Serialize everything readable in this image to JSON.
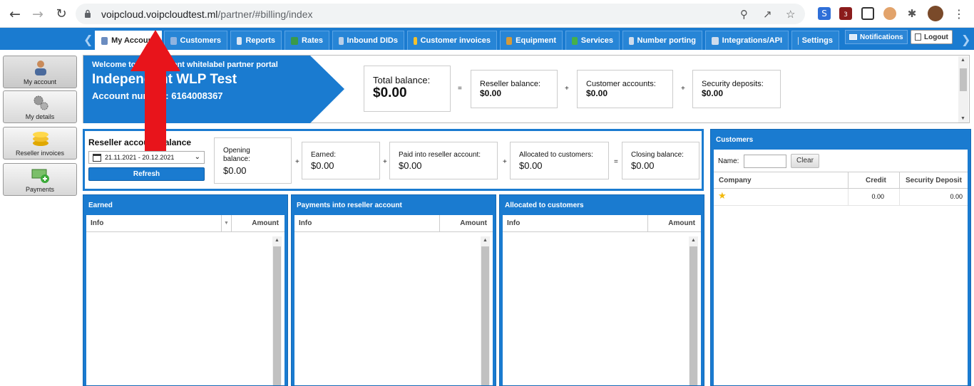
{
  "browser": {
    "url_host": "voipcloud.voipcloudtest.ml",
    "url_path": "/partner/#billing/index",
    "ext_badge": "3"
  },
  "nav": {
    "tabs": [
      {
        "label": "My Account",
        "icon": "user-icon",
        "color": "#6b8cc0"
      },
      {
        "label": "Customers",
        "icon": "customers-icon",
        "color": "#8fb3e0"
      },
      {
        "label": "Reports",
        "icon": "report-icon",
        "color": "#d9e6f5"
      },
      {
        "label": "Rates",
        "icon": "rates-icon",
        "color": "#3a9a4a"
      },
      {
        "label": "Inbound DIDs",
        "icon": "did-icon",
        "color": "#b9cfe8"
      },
      {
        "label": "Customer invoices",
        "icon": "coins-icon",
        "color": "#f2c12e"
      },
      {
        "label": "Equipment",
        "icon": "box-icon",
        "color": "#d39a3a"
      },
      {
        "label": "Services",
        "icon": "services-icon",
        "color": "#46b04a"
      },
      {
        "label": "Number porting",
        "icon": "phone-icon",
        "color": "#cfdcec"
      },
      {
        "label": "Integrations/API",
        "icon": "gear-icon",
        "color": "#cfdcec"
      },
      {
        "label": "Settings",
        "icon": "settings-icon",
        "color": "#cfdcec"
      }
    ],
    "notifications_label": "Notifications",
    "logout_label": "Logout"
  },
  "sidebar": {
    "items": [
      {
        "label": "My account",
        "icon": "user-icon"
      },
      {
        "label": "My details",
        "icon": "gears-icon"
      },
      {
        "label": "Reseller invoices",
        "icon": "coins-icon"
      },
      {
        "label": "Payments",
        "icon": "payment-icon"
      }
    ]
  },
  "header": {
    "welcome": "Welcome to Independent whitelabel partner portal",
    "name": "Independent WLP Test",
    "account_line": "Account number: 6164008367",
    "total_balance_label": "Total balance:",
    "total_balance_value": "$0.00",
    "reseller_balance_label": "Reseller balance:",
    "reseller_balance_value": "$0.00",
    "customer_accounts_label": "Customer accounts:",
    "customer_accounts_value": "$0.00",
    "security_deposits_label": "Security deposits:",
    "security_deposits_value": "$0.00",
    "eq": "=",
    "plus": "+"
  },
  "reseller_balance": {
    "title": "Reseller account balance",
    "date_range": "21.11.2021 - 20.12.2021",
    "refresh_label": "Refresh",
    "opening_label": "Opening balance:",
    "opening_value": "$0.00",
    "earned_label": "Earned:",
    "earned_value": "$0.00",
    "paid_label": "Paid into reseller account:",
    "paid_value": "$0.00",
    "allocated_label": "Allocated to customers:",
    "allocated_value": "$0.00",
    "closing_label": "Closing balance:",
    "closing_value": "$0.00",
    "plus": "+",
    "eq": "="
  },
  "panels": {
    "earned": {
      "title": "Earned",
      "col_info": "Info",
      "col_amount": "Amount"
    },
    "payments": {
      "title": "Payments into reseller account",
      "col_info": "Info",
      "col_amount": "Amount"
    },
    "allocated": {
      "title": "Allocated to customers",
      "col_info": "Info",
      "col_amount": "Amount"
    }
  },
  "customers": {
    "title": "Customers",
    "name_label": "Name:",
    "name_value": "",
    "clear_label": "Clear",
    "columns": [
      "Company",
      "Credit",
      "Security Deposit"
    ],
    "rows": [
      {
        "icon": "star-icon",
        "credit": "0.00",
        "deposit": "0.00"
      }
    ]
  },
  "colors": {
    "brand_blue": "#1a7bd0",
    "annotation_red": "#e8141b"
  }
}
